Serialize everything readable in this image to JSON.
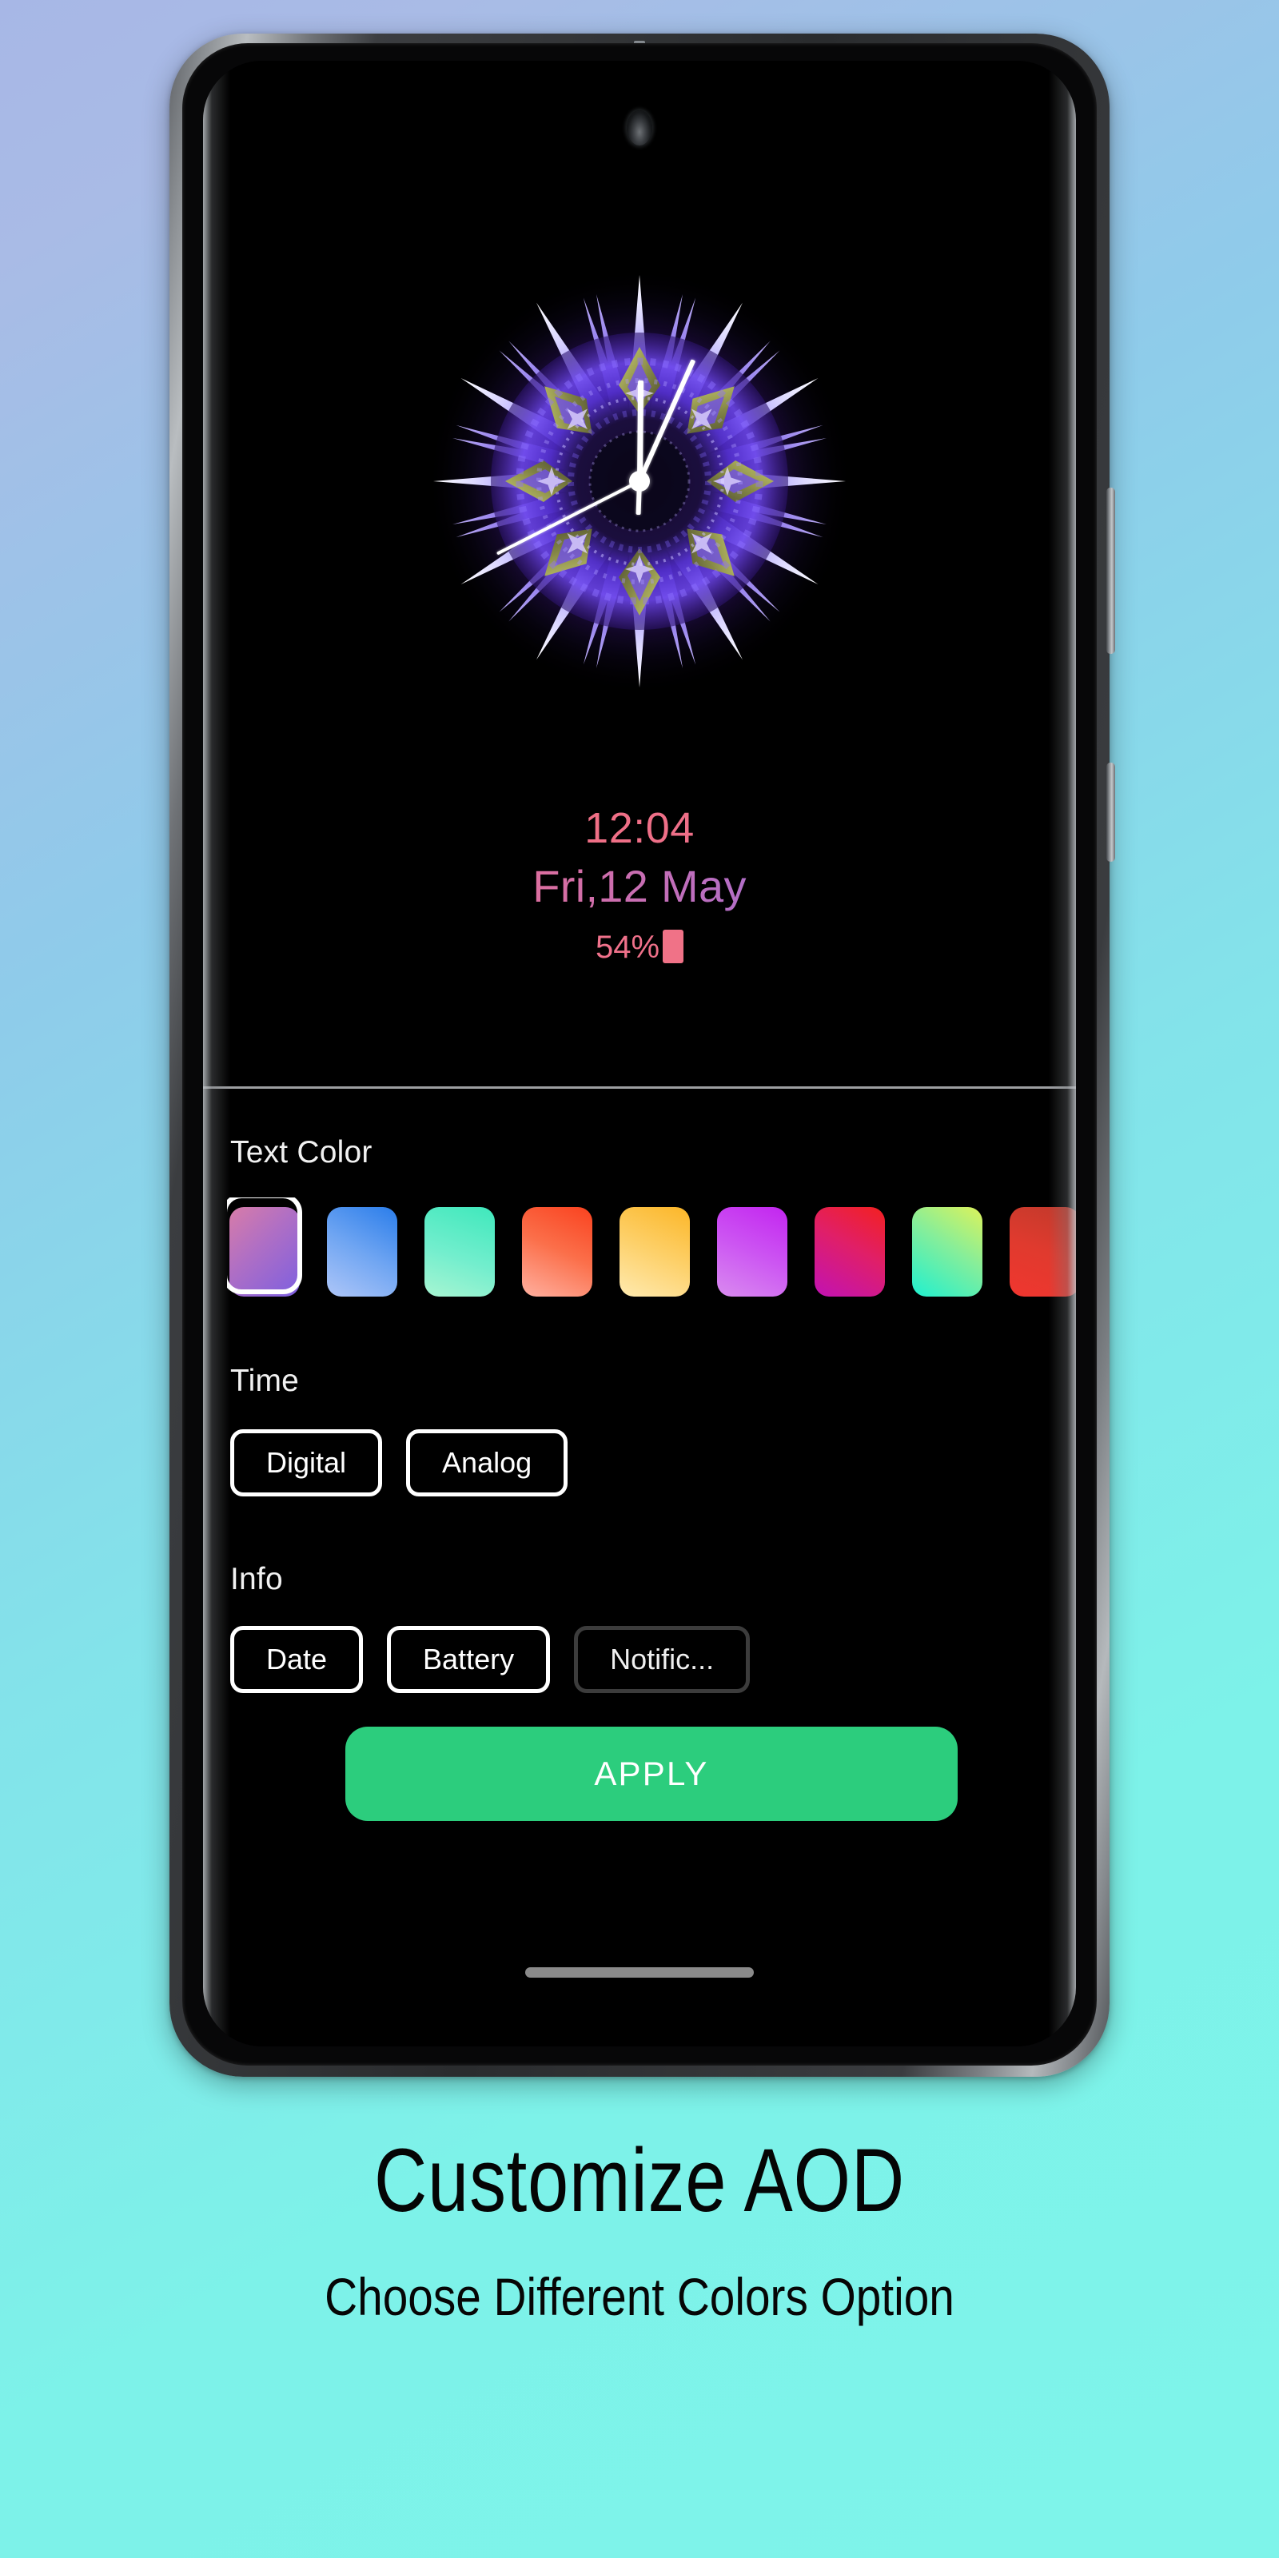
{
  "background": {
    "gradient_from": "#a7b7e6",
    "gradient_to": "#7ef4ea"
  },
  "device": {
    "camera_icon": "punch-hole-camera-icon",
    "home_indicator": "home-indicator",
    "side_buttons": [
      "volume-button",
      "power-button"
    ]
  },
  "aod_preview": {
    "clock_style": "analog-kaleidoscope",
    "time": "12:04",
    "date": "Fri,12 May",
    "battery_percent": "54%",
    "battery_icon": "battery-icon"
  },
  "settings": {
    "text_color": {
      "label": "Text Color",
      "selected_index": 0,
      "swatches": [
        {
          "name": "pink-purple",
          "from": "#d87ca8",
          "to": "#7d5fe0",
          "selected": true
        },
        {
          "name": "lightblue-blue",
          "from": "#aec6f8",
          "to": "#2a7dea",
          "selected": false
        },
        {
          "name": "mint",
          "from": "#a8f5d2",
          "to": "#3fe8bc",
          "selected": false
        },
        {
          "name": "orange-salmon",
          "from": "#ffb0a0",
          "to": "#f9421f",
          "selected": false
        },
        {
          "name": "amber-cream",
          "from": "#ffeab0",
          "to": "#fcb628",
          "selected": false
        },
        {
          "name": "magenta-violet",
          "from": "#d98bf0",
          "to": "#c325f0",
          "selected": false
        },
        {
          "name": "magenta-red",
          "from": "#c112b4",
          "to": "#f32020",
          "selected": false
        },
        {
          "name": "cyan-lime",
          "from": "#1ff0d0",
          "to": "#ddf25a",
          "selected": false
        },
        {
          "name": "red-partial",
          "from": "#c0392b",
          "to": "#f0362f",
          "selected": false
        }
      ]
    },
    "time": {
      "label": "Time",
      "options": [
        {
          "label": "Digital",
          "active": true
        },
        {
          "label": "Analog",
          "active": true
        }
      ]
    },
    "info": {
      "label": "Info",
      "options": [
        {
          "label": "Date",
          "active": true
        },
        {
          "label": "Battery",
          "active": true
        },
        {
          "label": "Notific...",
          "active": false
        }
      ]
    },
    "apply_label": "APPLY",
    "apply_color": "#2ccd7d"
  },
  "caption": {
    "title": "Customize AOD",
    "subtitle": "Choose Different Colors Option"
  }
}
